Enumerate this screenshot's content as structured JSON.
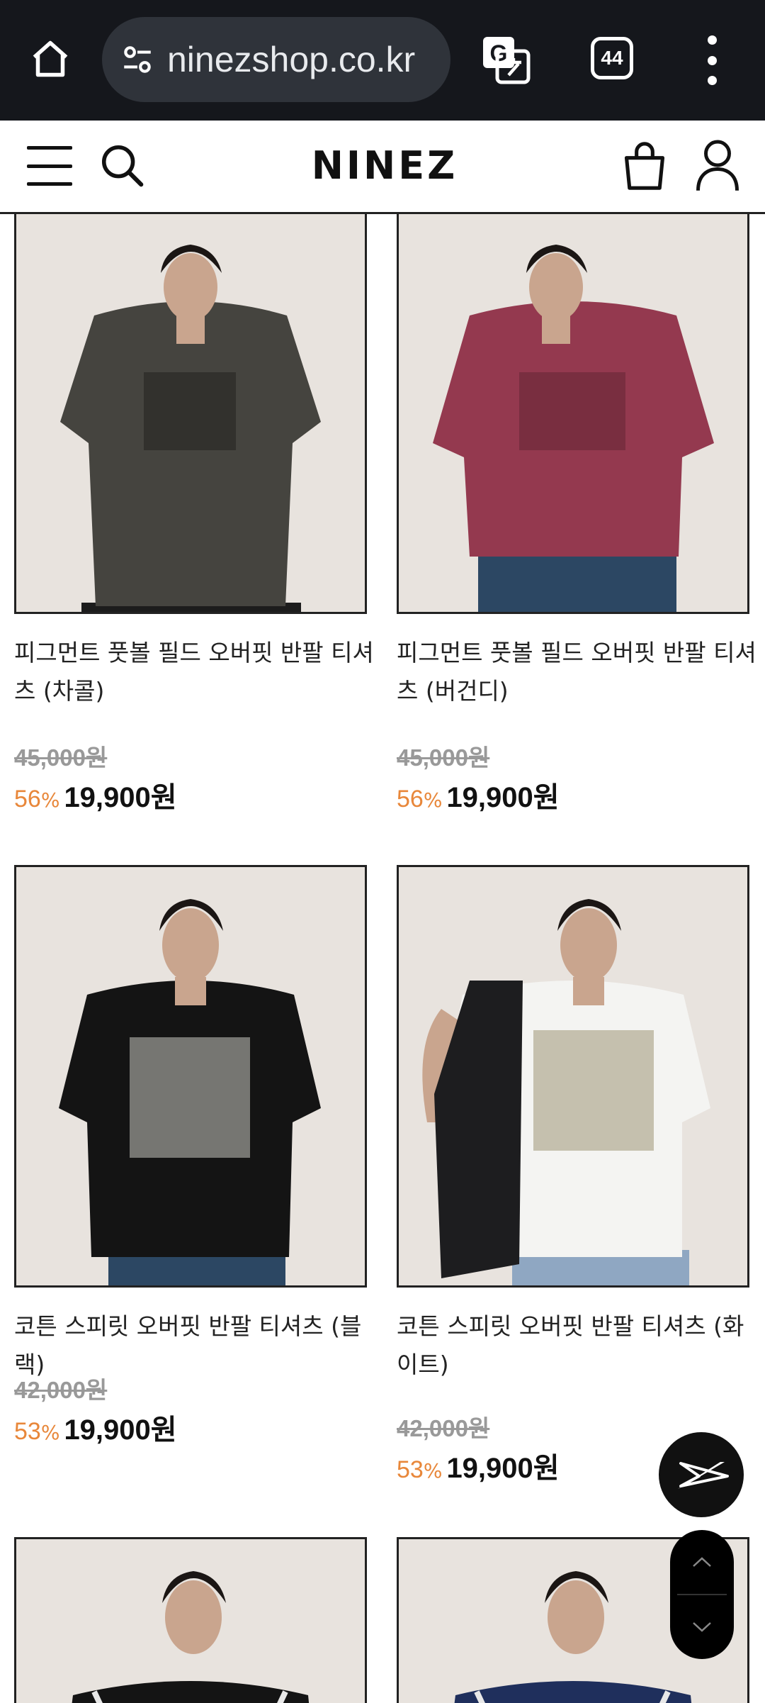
{
  "browser": {
    "url": "ninezshop.co.kr",
    "tab_count": "44"
  },
  "header": {
    "logo": "NINEZ"
  },
  "products": [
    {
      "name": "피그먼트 풋볼 필드 오버핏 반팔 티셔츠 (차콜)",
      "original_price": "45,000원",
      "discount": "56",
      "percent_sign": "%",
      "price": "19,900원",
      "shirt_color": "#45443f"
    },
    {
      "name": "피그먼트 풋볼 필드 오버핏 반팔 티셔츠 (버건디)",
      "original_price": "45,000원",
      "discount": "56",
      "percent_sign": "%",
      "price": "19,900원",
      "shirt_color": "#94394f"
    },
    {
      "name": "코튼 스피릿 오버핏 반팔 티셔츠 (블랙)",
      "original_price": "42,000원",
      "discount": "53",
      "percent_sign": "%",
      "price": "19,900원",
      "shirt_color": "#141414"
    },
    {
      "name": "코튼 스피릿 오버핏 반팔 티셔츠 (화이트)",
      "original_price": "42,000원",
      "discount": "53",
      "percent_sign": "%",
      "price": "19,900원",
      "shirt_color": "#f4f4f2"
    }
  ],
  "colors": {
    "accent_discount": "#e8873a",
    "browser_bar": "#15171c",
    "photo_bg": "#e9e4df"
  },
  "icons": {
    "home": "home-icon",
    "site_settings": "tune-icon",
    "translate": "translate-icon",
    "more": "more-vert-icon",
    "menu": "hamburger-icon",
    "search": "search-icon",
    "cart": "shopping-bag-icon",
    "account": "user-icon",
    "brand_fab": "brand-logo-icon",
    "scroll_up": "chevron-up-icon",
    "scroll_down": "chevron-down-icon"
  }
}
